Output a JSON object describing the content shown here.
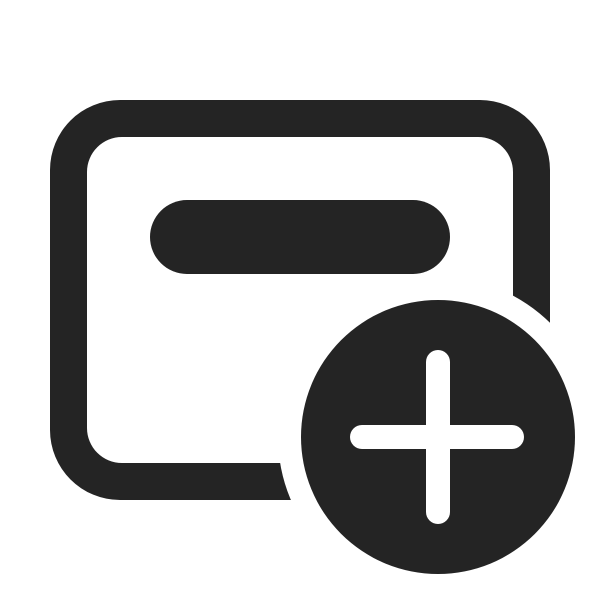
{
  "icon": {
    "name": "window-add-icon",
    "color": "#242424",
    "background": "#ffffff",
    "parts": [
      "window-frame",
      "title-bar",
      "add-badge",
      "plus-sign"
    ]
  }
}
